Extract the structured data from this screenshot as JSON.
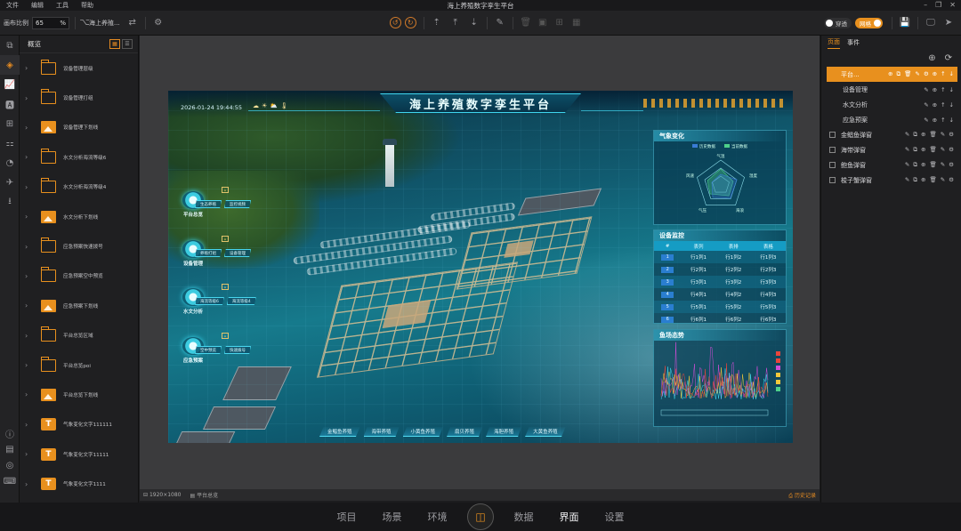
{
  "menu": {
    "items": [
      "文件",
      "编辑",
      "工具",
      "帮助"
    ],
    "window_title": "海上养殖数字孪生平台"
  },
  "toolbar": {
    "scale_label": "画布比例",
    "scale_value": "65",
    "scale_unit": "%",
    "page_select": "海上养殖..."
  },
  "toggles": {
    "through": "穿透",
    "grid": "网格"
  },
  "left_panel": {
    "title": "概览",
    "items": [
      {
        "type": "folder",
        "label": "设备管理层级"
      },
      {
        "type": "folder",
        "label": "设备管理打组"
      },
      {
        "type": "image",
        "label": "设备管理下划线"
      },
      {
        "type": "folder",
        "label": "水文分析海流等级6"
      },
      {
        "type": "folder",
        "label": "水文分析海流等级4"
      },
      {
        "type": "image",
        "label": "水文分析下划线"
      },
      {
        "type": "folder",
        "label": "应急预案快速拨号"
      },
      {
        "type": "folder",
        "label": "应急预案空中预览"
      },
      {
        "type": "image",
        "label": "应急预案下划线"
      },
      {
        "type": "folder",
        "label": "平台总览区域"
      },
      {
        "type": "folder",
        "label": "平台总览poi"
      },
      {
        "type": "image",
        "label": "平台总览下划线"
      },
      {
        "type": "text",
        "label": "气象变化文字111111"
      },
      {
        "type": "text",
        "label": "气象变化文字11111"
      },
      {
        "type": "text",
        "label": "气象变化文字1111"
      }
    ]
  },
  "stage": {
    "title": "海上养殖数字孪生平台",
    "datetime": "2026-01-24 19:44:55",
    "left_nav": [
      {
        "label": "平台总览",
        "btns": [
          "生态养殖",
          "监控视频"
        ]
      },
      {
        "label": "设备管理",
        "btns": [
          "养殖打组",
          "设备管理"
        ]
      },
      {
        "label": "水文分析",
        "btns": [
          "海流等级6",
          "海流等级4"
        ]
      },
      {
        "label": "应急预案",
        "btns": [
          "空中预览",
          "快速拨号"
        ]
      }
    ],
    "bottom_tabs": [
      "金鲳鱼养殖",
      "海带养殖",
      "小黄鱼养殖",
      "扇贝养殖",
      "海胆养殖",
      "大黄鱼养殖"
    ],
    "weather_panel": {
      "title": "气象变化",
      "legend": [
        "历史数据",
        "当前数据"
      ],
      "axes": [
        "气温",
        "湿度",
        "海浪",
        "气压",
        "风速"
      ]
    },
    "device_panel": {
      "title": "设备监控",
      "headers": [
        "#",
        "表列",
        "表排",
        "表格"
      ],
      "rows": [
        [
          "1",
          "行1列1",
          "行1列2",
          "行1列3"
        ],
        [
          "2",
          "行2列1",
          "行2列2",
          "行2列3"
        ],
        [
          "3",
          "行3列1",
          "行3列2",
          "行3列3"
        ],
        [
          "4",
          "行4列1",
          "行4列2",
          "行4列3"
        ],
        [
          "5",
          "行5列1",
          "行5列2",
          "行5列3"
        ],
        [
          "6",
          "行6列1",
          "行6列2",
          "行6列3"
        ]
      ]
    },
    "trend_panel": {
      "title": "鱼场态势"
    }
  },
  "right_panel": {
    "tabs": [
      "页面",
      "事件"
    ],
    "rows": [
      {
        "label": "平台...",
        "selected": true,
        "indent": false,
        "box": false
      },
      {
        "label": "设备管理",
        "selected": false,
        "indent": true,
        "box": false
      },
      {
        "label": "水文分析",
        "selected": false,
        "indent": true,
        "box": false
      },
      {
        "label": "应急预案",
        "selected": false,
        "indent": true,
        "box": false
      },
      {
        "label": "金鲳鱼弹窗",
        "selected": false,
        "indent": false,
        "box": true
      },
      {
        "label": "海带弹窗",
        "selected": false,
        "indent": false,
        "box": true
      },
      {
        "label": "鲍鱼弹窗",
        "selected": false,
        "indent": false,
        "box": true
      },
      {
        "label": "梭子蟹弹窗",
        "selected": false,
        "indent": false,
        "box": true
      }
    ]
  },
  "status": {
    "resolution": "1920×1080",
    "platform": "平台总览",
    "history": "历史记录"
  },
  "bottom_nav": {
    "items": [
      "项目",
      "场景",
      "环境",
      "数据",
      "界面",
      "设置"
    ],
    "active": "界面"
  },
  "colors": {
    "accent": "#e8901e",
    "cyan": "#3fd6ef",
    "bg": "#1c1c1e"
  }
}
